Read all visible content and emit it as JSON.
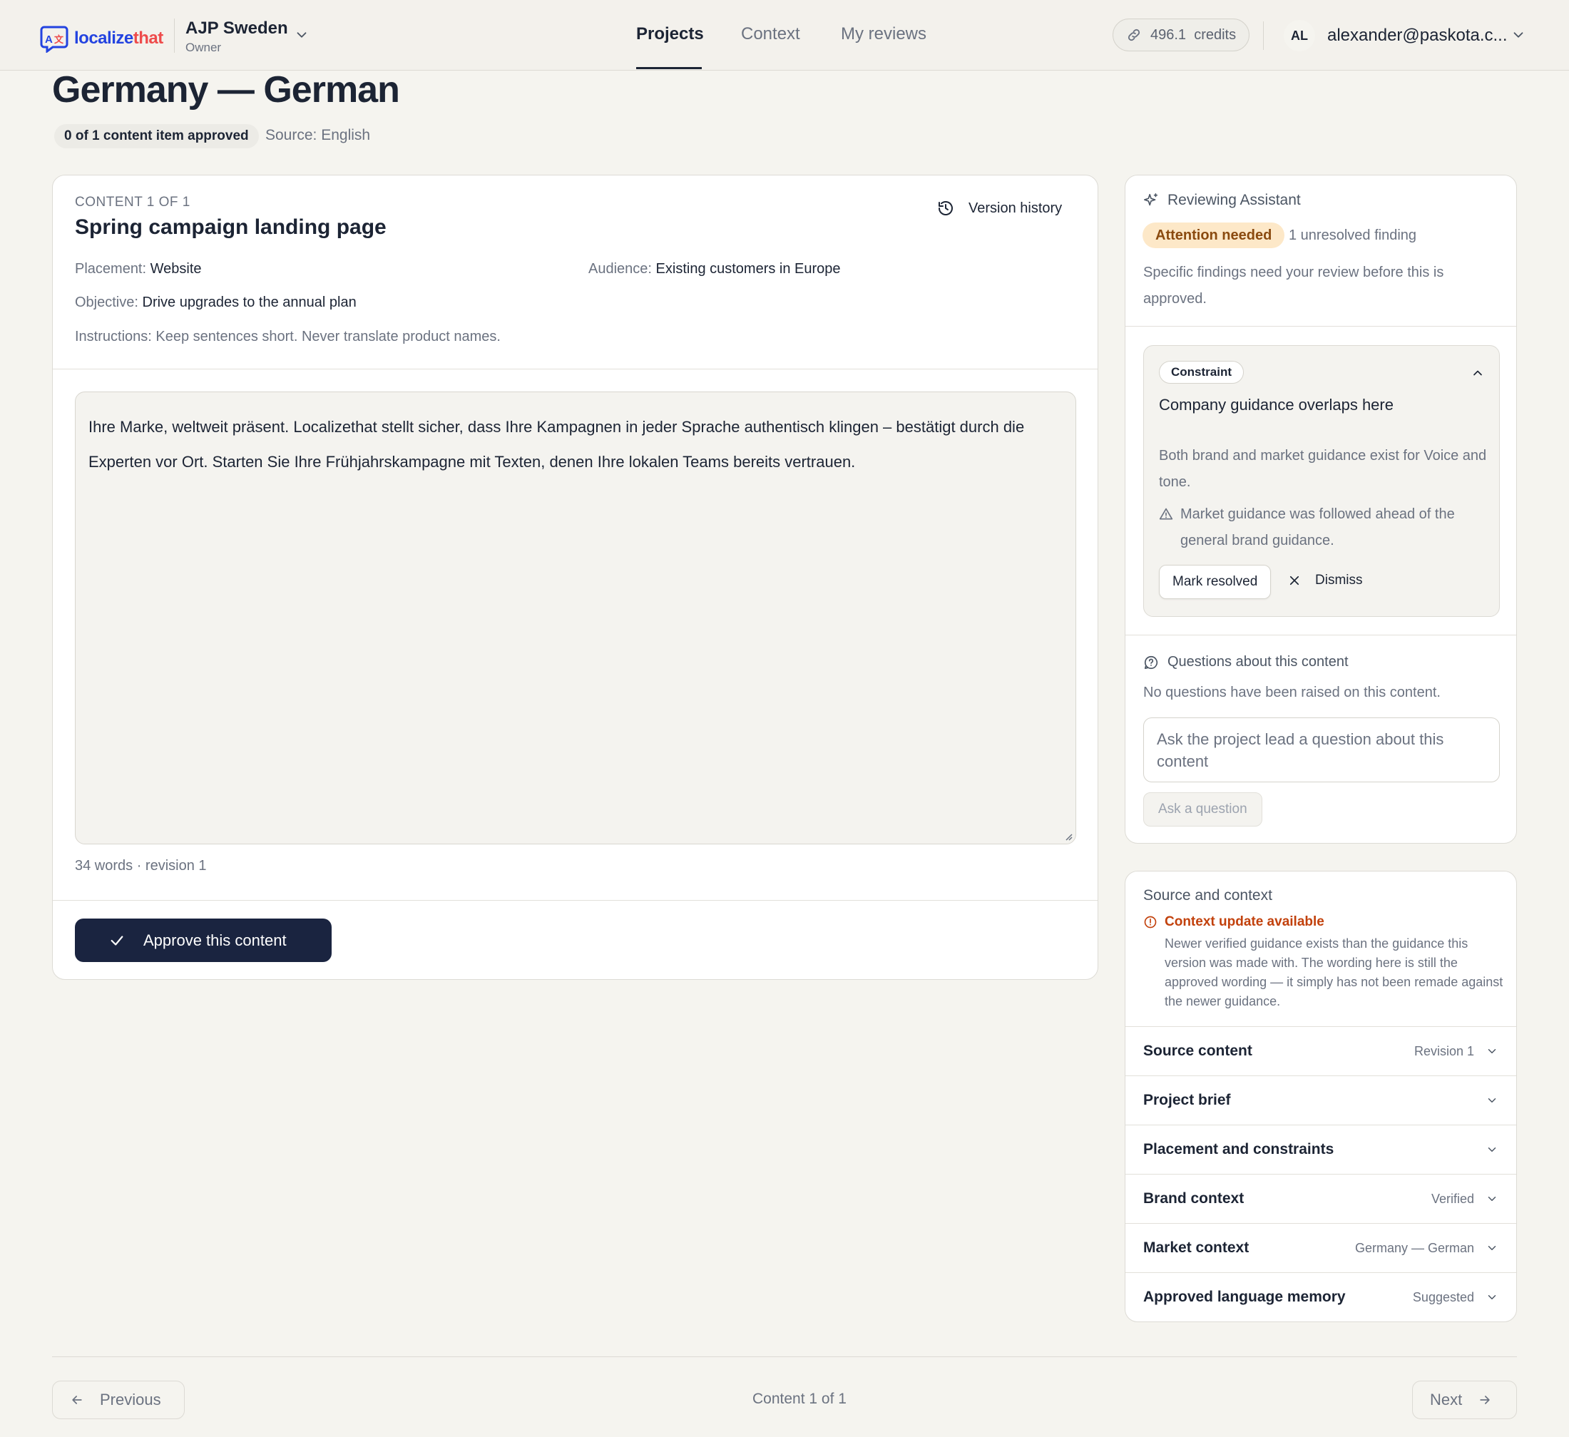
{
  "header": {
    "logo_text_a": "localize",
    "logo_text_b": "that",
    "org_name": "AJP Sweden",
    "org_role": "Owner",
    "nav": [
      {
        "label": "Projects",
        "active": true
      },
      {
        "label": "Context",
        "active": false
      },
      {
        "label": "My reviews",
        "active": false
      }
    ],
    "credits_value": "496.1",
    "credits_label": "credits",
    "avatar_initials": "AL",
    "user_email": "alexander@paskota.c..."
  },
  "page": {
    "title": "Germany — German",
    "approved_status": "0 of 1 content item approved",
    "source_language": "Source: English"
  },
  "content": {
    "count_label": "CONTENT 1 OF 1",
    "title": "Spring campaign landing page",
    "version_history_label": "Version history",
    "placement_label": "Placement:",
    "placement_value": "Website",
    "audience_label": "Audience:",
    "audience_value": "Existing customers in Europe",
    "objective_label": "Objective:",
    "objective_value": "Drive upgrades to the annual plan",
    "instructions": "Instructions: Keep sentences short. Never translate product names.",
    "body_text": "Ihre Marke, weltweit präsent. Localizethat stellt sicher, dass Ihre Kampagnen in jeder Sprache authentisch klingen – bestätigt durch die Experten vor Ort. Starten Sie Ihre Frühjahrskampagne mit Texten, denen Ihre lokalen Teams bereits vertrauen.",
    "word_count": "34 words · revision 1",
    "approve_label": "Approve this content"
  },
  "assistant": {
    "title": "Reviewing Assistant",
    "status_badge": "Attention needed",
    "unresolved": "1 unresolved finding",
    "description": "Specific findings need your review before this is approved.",
    "finding": {
      "tag": "Constraint",
      "title": "Company guidance overlaps here",
      "description": "Both brand and market guidance exist for Voice and tone.",
      "note": "Market guidance was followed ahead of the general brand guidance.",
      "resolve_label": "Mark resolved",
      "dismiss_label": "Dismiss"
    },
    "questions_title": "Questions about this content",
    "no_questions": "No questions have been raised on this content.",
    "question_placeholder": "Ask the project lead a question about this content",
    "ask_label": "Ask a question"
  },
  "context": {
    "title": "Source and context",
    "update_title": "Context update available",
    "update_desc": "Newer verified guidance exists than the guidance this version was made with. The wording here is still the approved wording — it simply has not been remade against the newer guidance.",
    "rows": [
      {
        "label": "Source content",
        "meta": "Revision 1"
      },
      {
        "label": "Project brief",
        "meta": ""
      },
      {
        "label": "Placement and constraints",
        "meta": ""
      },
      {
        "label": "Brand context",
        "meta": "Verified"
      },
      {
        "label": "Market context",
        "meta": "Germany — German"
      },
      {
        "label": "Approved language memory",
        "meta": "Suggested"
      }
    ]
  },
  "pager": {
    "previous_label": "Previous",
    "position_label": "Content 1 of 1",
    "next_label": "Next"
  },
  "colors": {
    "brand_blue": "#2343e0",
    "brand_red": "#ee4b4b",
    "primary_dark": "#1a2440",
    "attention_bg": "#fde8c8",
    "attention_text": "#8a4a0f",
    "warning_orange": "#c2410c"
  },
  "icons": {
    "logo": "localizethat-logo-icon",
    "credits": "link-icon",
    "version_history": "history-icon",
    "approve": "check-icon",
    "assistant": "sparkles-icon",
    "finding_note": "warning-triangle-icon",
    "dismiss": "close-icon",
    "questions": "question-bubble-icon",
    "context_update": "alert-circle-icon"
  }
}
